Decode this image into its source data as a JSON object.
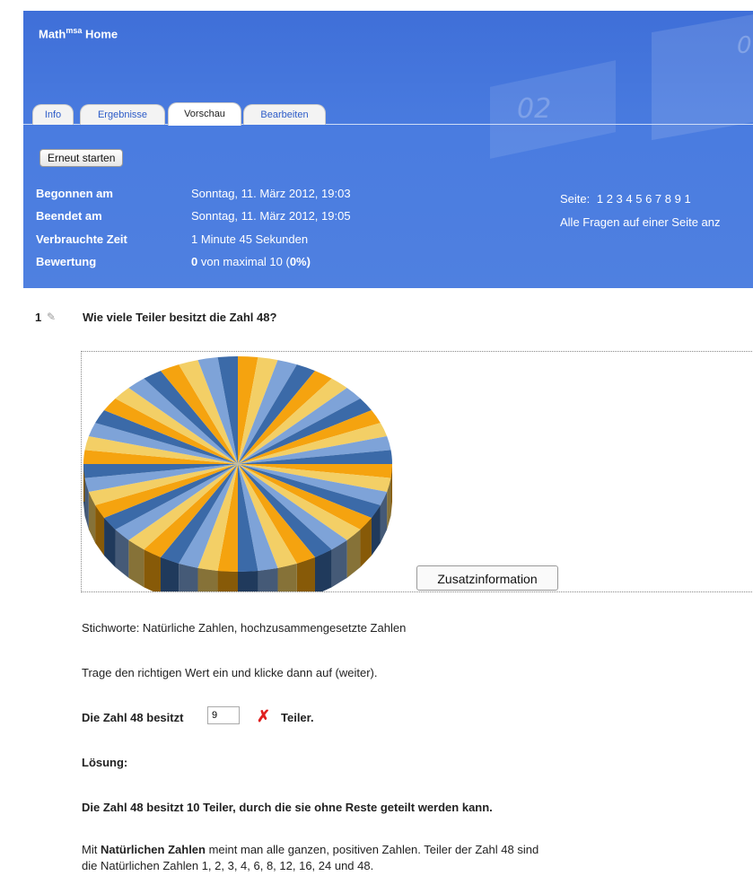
{
  "header": {
    "brand_name": "Math",
    "brand_sup": "msa",
    "brand_home": "Home",
    "deco_text_1": "02",
    "deco_text_2": "0"
  },
  "tabs": [
    {
      "label": "Info",
      "active": false
    },
    {
      "label": "Ergebnisse",
      "active": false
    },
    {
      "label": "Vorschau",
      "active": true
    },
    {
      "label": "Bearbeiten",
      "active": false
    }
  ],
  "restart_button": "Erneut starten",
  "attempt": {
    "begun_label": "Begonnen am",
    "begun_value": "Sonntag, 11. März 2012, 19:03",
    "ended_label": "Beendet am",
    "ended_value": "Sonntag, 11. März 2012, 19:05",
    "time_label": "Verbrauchte Zeit",
    "time_value": "1 Minute 45 Sekunden",
    "grade_label": "Bewertung",
    "grade_score": "0",
    "grade_rest": " von maximal 10 (",
    "grade_percent": "0%",
    "grade_close": ")"
  },
  "pager": {
    "label": "Seite:",
    "pages": "1  2  3  4  5  6  7  8  9  1",
    "all_questions": "Alle Fragen auf einer Seite anz"
  },
  "question": {
    "number": "1",
    "pencil_icon": "pencil-icon",
    "text": "Wie viele Teiler besitzt die Zahl 48?",
    "info_button": "Zusatzinformation",
    "keywords": "Stichworte: Natürliche Zahlen, hochzusammengesetzte Zahlen",
    "instruction": "Trage den richtigen Wert ein und klicke dann auf (weiter).",
    "answer_prefix": "Die Zahl 48 besitzt",
    "answer_value": "9",
    "answer_suffix": "Teiler.",
    "wrong_icon": "cross-icon",
    "solution_label": "Lösung:",
    "solution_text": "Die Zahl 48 besitzt 10 Teiler, durch die sie ohne Reste geteilt werden kann.",
    "explain_1_pre": "Mit ",
    "explain_1_bold": "Natürlichen Zahlen",
    "explain_1_post": " meint man alle ganzen, positiven Zahlen. Teiler der Zahl 48 sind",
    "explain_2": "die Natürlichen Zahlen 1, 2, 3, 4, 6, 8, 12, 16, 24 und 48."
  },
  "pie_illustration": {
    "slices": 48,
    "colors": [
      "#f5a30f",
      "#f3cf66",
      "#7ea3d8",
      "#3b6aa8"
    ]
  }
}
